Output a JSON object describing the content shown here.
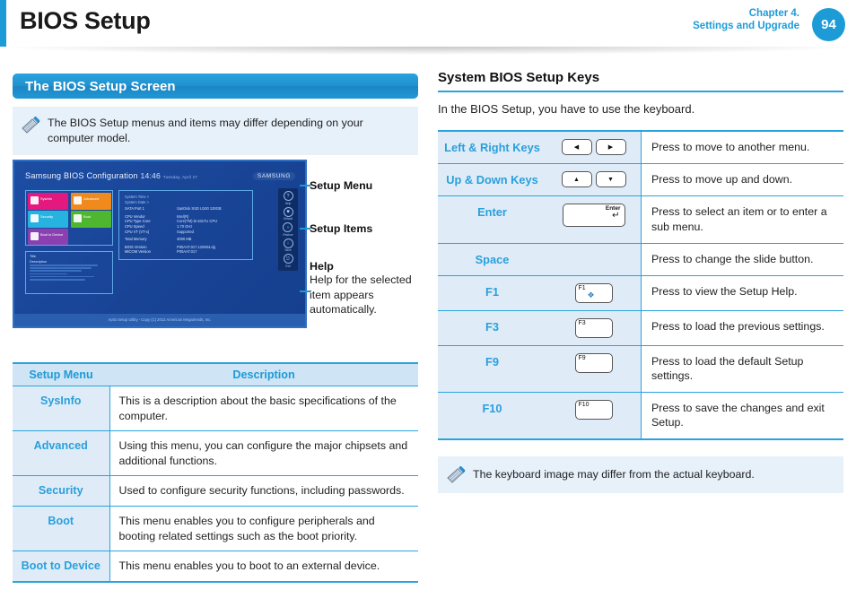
{
  "header": {
    "title": "BIOS Setup",
    "chapter": "Chapter 4.",
    "section": "Settings and Upgrade",
    "page_number": "94",
    "accent_color": "#1d9bd7"
  },
  "left": {
    "section_title": "The BIOS Setup Screen",
    "note": "The BIOS Setup menus and items may differ depending on your computer model.",
    "note_icon": "note-pencil-icon",
    "bios_screen": {
      "title": "Samsung BIOS Configuration",
      "time": "14:46",
      "date": "Tuesday, April 27",
      "brand": "SAMSUNG",
      "tiles": [
        {
          "label": "SysInfo",
          "color": "#e3197f",
          "icon": "home-icon"
        },
        {
          "label": "Advanced",
          "color": "#f08a1c",
          "icon": "wrench-icon"
        },
        {
          "label": "Security",
          "color": "#27b3e0",
          "icon": "lock-icon"
        },
        {
          "label": "Boot",
          "color": "#4fb630",
          "icon": "disc-icon"
        },
        {
          "label": "Boot to Device",
          "color": "#8c3fb0",
          "icon": "device-icon"
        }
      ],
      "info_rows": [
        {
          "key": "System Time >",
          "value": ""
        },
        {
          "key": "System Date >",
          "value": ""
        },
        {
          "key": "SATA Port 1",
          "value": "SanDisk SSD U100 128GB"
        },
        {
          "key": "CPU Vendor",
          "value": "Intel(R)"
        },
        {
          "key": "CPU Type Core",
          "value": "Core(TM) i5-3317U CPU"
        },
        {
          "key": "CPU Speed",
          "value": "1.70 GHz"
        },
        {
          "key": "CPU VT (VT-x)",
          "value": "Supported"
        },
        {
          "key": "Total Memory",
          "value": "4096 MB"
        },
        {
          "key": "BIOS Version",
          "value": "P00AAT.017.120804.dg"
        },
        {
          "key": "MICOM Version",
          "value": "P00AAT.017"
        }
      ],
      "help_title": "Title",
      "help_desc": "Description",
      "sidebar_icons": [
        {
          "label": "Help",
          "glyph": "?",
          "icon": "help-icon"
        },
        {
          "label": "Default",
          "glyph": "▬",
          "icon": "default-icon"
        },
        {
          "label": "Restore",
          "glyph": "○",
          "icon": "restore-icon"
        },
        {
          "label": "Save",
          "glyph": "↓",
          "icon": "save-icon"
        },
        {
          "label": "Exit",
          "glyph": "⏻",
          "icon": "exit-icon"
        }
      ],
      "footer": "Aptio Setup Utility - Copy (C) 2012 American Megatrends, Inc."
    },
    "callouts": [
      {
        "title": "Setup Menu",
        "body": ""
      },
      {
        "title": "Setup Items",
        "body": ""
      },
      {
        "title": "Help",
        "body": "Help for the selected item appears automatically."
      }
    ],
    "table": {
      "headers": [
        "Setup Menu",
        "Description"
      ],
      "rows": [
        {
          "menu": "SysInfo",
          "desc": "This is a description about the basic specifications of the computer."
        },
        {
          "menu": "Advanced",
          "desc": "Using this menu, you can configure the major chipsets and additional functions."
        },
        {
          "menu": "Security",
          "desc": "Used to configure security functions, including passwords."
        },
        {
          "menu": "Boot",
          "desc": "This menu enables you to configure peripherals and booting related settings such as the boot priority."
        },
        {
          "menu": "Boot to Device",
          "desc": "This menu enables you to boot to an external device."
        }
      ]
    }
  },
  "right": {
    "section_title": "System BIOS Setup Keys",
    "intro": "In the BIOS Setup, you have to use the keyboard.",
    "table": {
      "rows": [
        {
          "key": "Left & Right Keys",
          "keycap": "arrows-lr",
          "desc": "Press to move to another menu."
        },
        {
          "key": "Up & Down Keys",
          "keycap": "arrows-ud",
          "desc": "Press to move up and down."
        },
        {
          "key": "Enter",
          "keycap": "enter",
          "keycap_label": "Enter",
          "desc": "Press to select an item or to enter a sub menu."
        },
        {
          "key": "Space",
          "keycap": "none",
          "desc": "Press to change the slide button."
        },
        {
          "key": "F1",
          "keycap": "fn",
          "keycap_label": "F1",
          "desc": "Press to view the Setup Help."
        },
        {
          "key": "F3",
          "keycap": "fn",
          "keycap_label": "F3",
          "desc": "Press to load the previous settings."
        },
        {
          "key": "F9",
          "keycap": "fn",
          "keycap_label": "F9",
          "desc": "Press to load the default Setup settings."
        },
        {
          "key": "F10",
          "keycap": "fn",
          "keycap_label": "F10",
          "desc": "Press to save the changes and exit Setup."
        }
      ]
    },
    "note": "The keyboard image may differ from the actual keyboard.",
    "note_icon": "note-pencil-icon"
  }
}
